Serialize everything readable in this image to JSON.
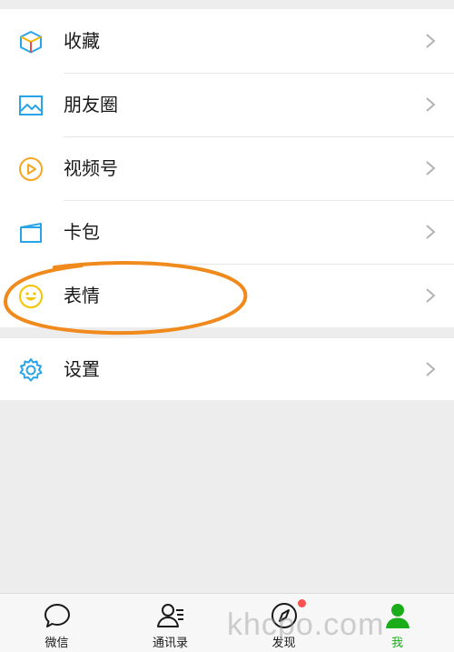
{
  "menu": {
    "items": [
      {
        "label": "收藏",
        "icon": "favorites-cube-icon"
      },
      {
        "label": "朋友圈",
        "icon": "moments-image-icon"
      },
      {
        "label": "视频号",
        "icon": "channels-play-icon"
      },
      {
        "label": "卡包",
        "icon": "card-wallet-icon"
      },
      {
        "label": "表情",
        "icon": "sticker-smile-icon"
      }
    ],
    "settings": {
      "label": "设置",
      "icon": "gear-icon"
    }
  },
  "annotation_color": "#f08a1c",
  "accent_color": "#1aad19",
  "tabbar": {
    "tabs": [
      {
        "label": "微信",
        "icon": "chat-bubble-icon"
      },
      {
        "label": "通讯录",
        "icon": "contacts-icon"
      },
      {
        "label": "发现",
        "icon": "compass-icon",
        "badge": "red-dot"
      },
      {
        "label": "我",
        "icon": "me-person-icon",
        "active": true
      }
    ]
  },
  "watermark": "khcpo.com"
}
